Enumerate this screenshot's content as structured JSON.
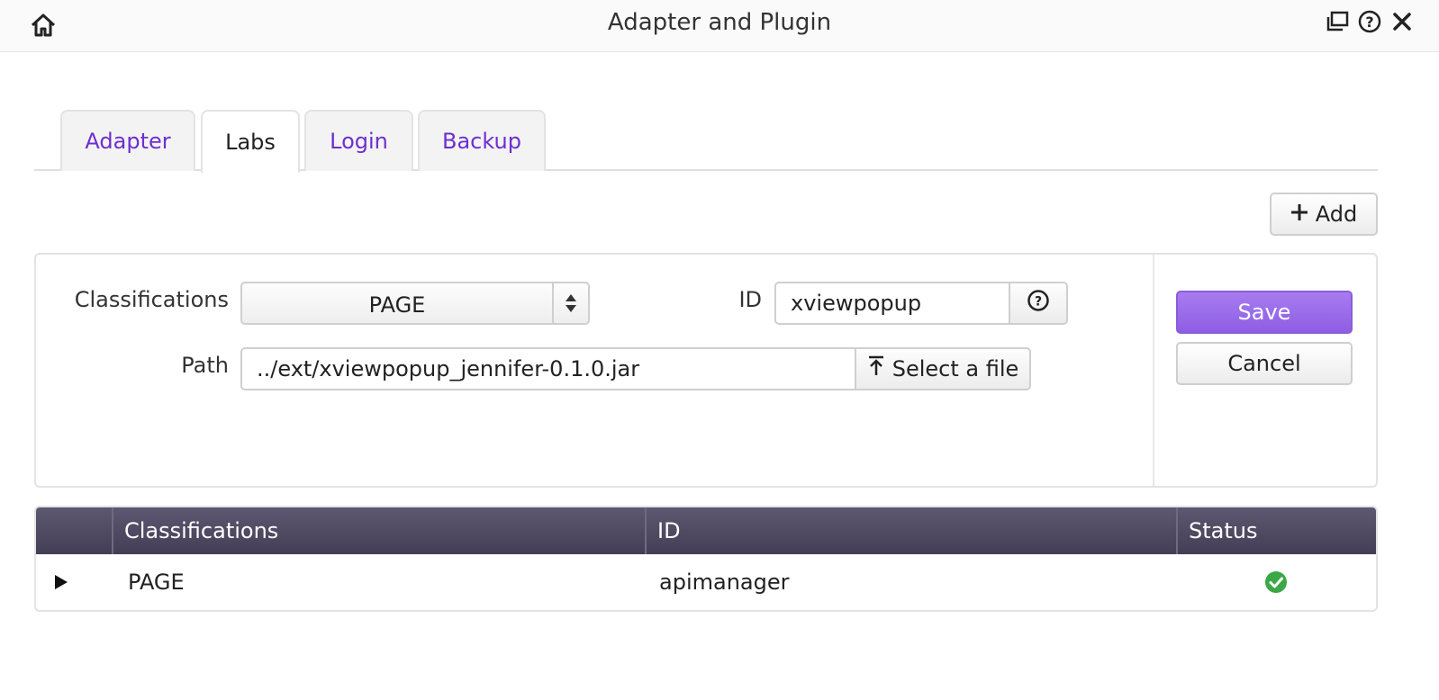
{
  "window": {
    "title": "Adapter and Plugin"
  },
  "tabs": [
    {
      "label": "Adapter",
      "active": false
    },
    {
      "label": "Labs",
      "active": true
    },
    {
      "label": "Login",
      "active": false
    },
    {
      "label": "Backup",
      "active": false
    }
  ],
  "toolbar": {
    "add_label": "Add"
  },
  "form": {
    "classifications_label": "Classifications",
    "classifications_value": "PAGE",
    "id_label": "ID",
    "id_value": "xviewpopup",
    "path_label": "Path",
    "path_value": "../ext/xviewpopup_jennifer-0.1.0.jar",
    "select_file_label": "Select a file",
    "save_label": "Save",
    "cancel_label": "Cancel"
  },
  "table": {
    "columns": [
      "Classifications",
      "ID",
      "Status"
    ],
    "rows": [
      {
        "classification": "PAGE",
        "id": "apimanager",
        "status": "ok"
      }
    ]
  },
  "colors": {
    "accent": "#8d5ee3",
    "tab_link": "#6d2fd0",
    "header_bg": "#4c475e",
    "status_ok": "#3aa845"
  }
}
